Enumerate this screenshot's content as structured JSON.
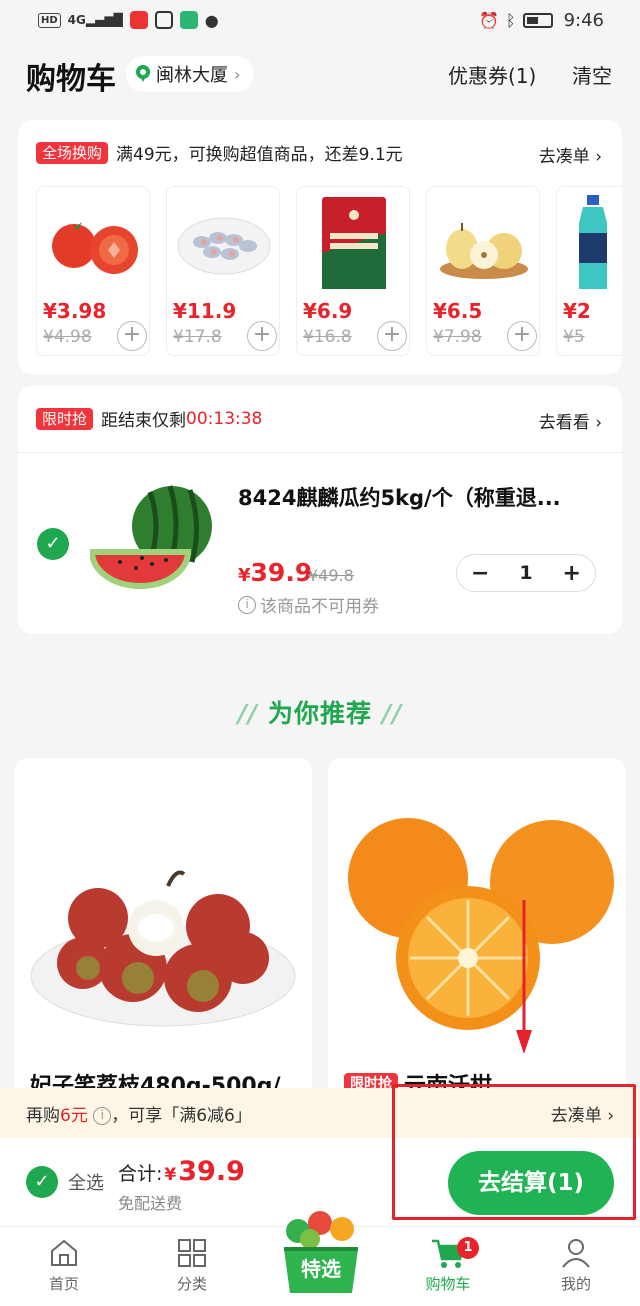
{
  "status_bar": {
    "network": "HD",
    "signal": "4G",
    "time": "9:46"
  },
  "header": {
    "title": "购物车",
    "location": "闽林大厦",
    "coupon": "优惠券(1)",
    "clear": "清空"
  },
  "exchange": {
    "tag": "全场换购",
    "text": "满49元，可换购超值商品，还差9.1元",
    "link": "去凑单",
    "products": [
      {
        "icon": "tomato-icon",
        "price": "¥3.98",
        "orig": "¥4.98"
      },
      {
        "icon": "fish-icon",
        "price": "¥11.9",
        "orig": "¥17.8"
      },
      {
        "icon": "snack-bag-icon",
        "price": "¥6.9",
        "orig": "¥16.8"
      },
      {
        "icon": "pear-icon",
        "price": "¥6.5",
        "orig": "¥7.98"
      },
      {
        "icon": "drink-bottle-icon",
        "price": "¥2",
        "orig": "¥5"
      }
    ]
  },
  "flash": {
    "tag": "限时抢",
    "label": "距结束仅剩",
    "countdown": "00:13:38",
    "link": "去看看"
  },
  "cart_item": {
    "name": "8424麒麟瓜约5kg/个（称重退...",
    "price_symbol": "¥",
    "price": "39.9",
    "orig": "¥49.8",
    "note": "该商品不可用券",
    "quantity": "1",
    "checked": true
  },
  "recommend": {
    "title": "为你推荐",
    "items": [
      {
        "icon": "lychee-icon",
        "name": "妃子笑荔枝480g-500g/",
        "tag": ""
      },
      {
        "icon": "orange-icon",
        "name": "云南沃柑",
        "tag": "限时抢"
      }
    ]
  },
  "promo": {
    "prefix": "再购",
    "amount": "6元",
    "suffix": "，可享「满6减6」",
    "link": "去凑单"
  },
  "checkout": {
    "select_all": "全选",
    "total_label": "合计:",
    "currency": "¥",
    "total": "39.9",
    "shipping": "免配送费",
    "button": "去结算(1)"
  },
  "tabs": [
    {
      "label": "首页",
      "icon": "home-icon"
    },
    {
      "label": "分类",
      "icon": "grid-icon"
    },
    {
      "label": "特选",
      "icon": "featured-basket-icon"
    },
    {
      "label": "购物车",
      "icon": "cart-icon",
      "badge": "1"
    },
    {
      "label": "我的",
      "icon": "user-icon"
    }
  ],
  "colors": {
    "brand_green": "#1fa84f",
    "price_red": "#e8232b",
    "highlight_box": "#e3222c"
  }
}
